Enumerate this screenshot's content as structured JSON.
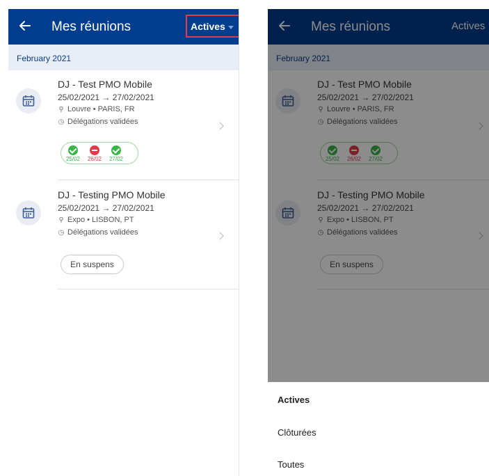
{
  "header": {
    "back_label": "←",
    "title": "Mes réunions",
    "filter_label": "Actives",
    "brand_color": "#003d8f",
    "highlight_color": "#e53945"
  },
  "month_section": {
    "label": "February 2021"
  },
  "meetings": [
    {
      "title": "DJ - Test PMO Mobile",
      "dates": "25/02/2021 → 27/02/2021",
      "location": "Louvre • PARIS, FR",
      "status": "Délégations validées",
      "days": [
        {
          "date": "25/02",
          "state": "validated"
        },
        {
          "date": "26/02",
          "state": "rejected"
        },
        {
          "date": "27/02",
          "state": "validated"
        }
      ]
    },
    {
      "title": "DJ - Testing PMO Mobile",
      "dates": "25/02/2021 → 27/02/2021",
      "location": "Expo • LISBON, PT",
      "status": "Délégations validées",
      "badge": "En suspens"
    }
  ],
  "filter_sheet": {
    "options": [
      "Actives",
      "Clôturées",
      "Toutes"
    ],
    "selected": "Actives"
  },
  "icons": {
    "back": "arrow-left-icon",
    "calendar": "calendar-icon",
    "location": "location-pin-icon",
    "clock": "clock-icon",
    "chevron": "chevron-right-icon",
    "dropdown": "caret-down-icon"
  },
  "colors": {
    "validated": "#3ab54a",
    "rejected": "#e23a47",
    "month_bg": "#e9eef6"
  }
}
